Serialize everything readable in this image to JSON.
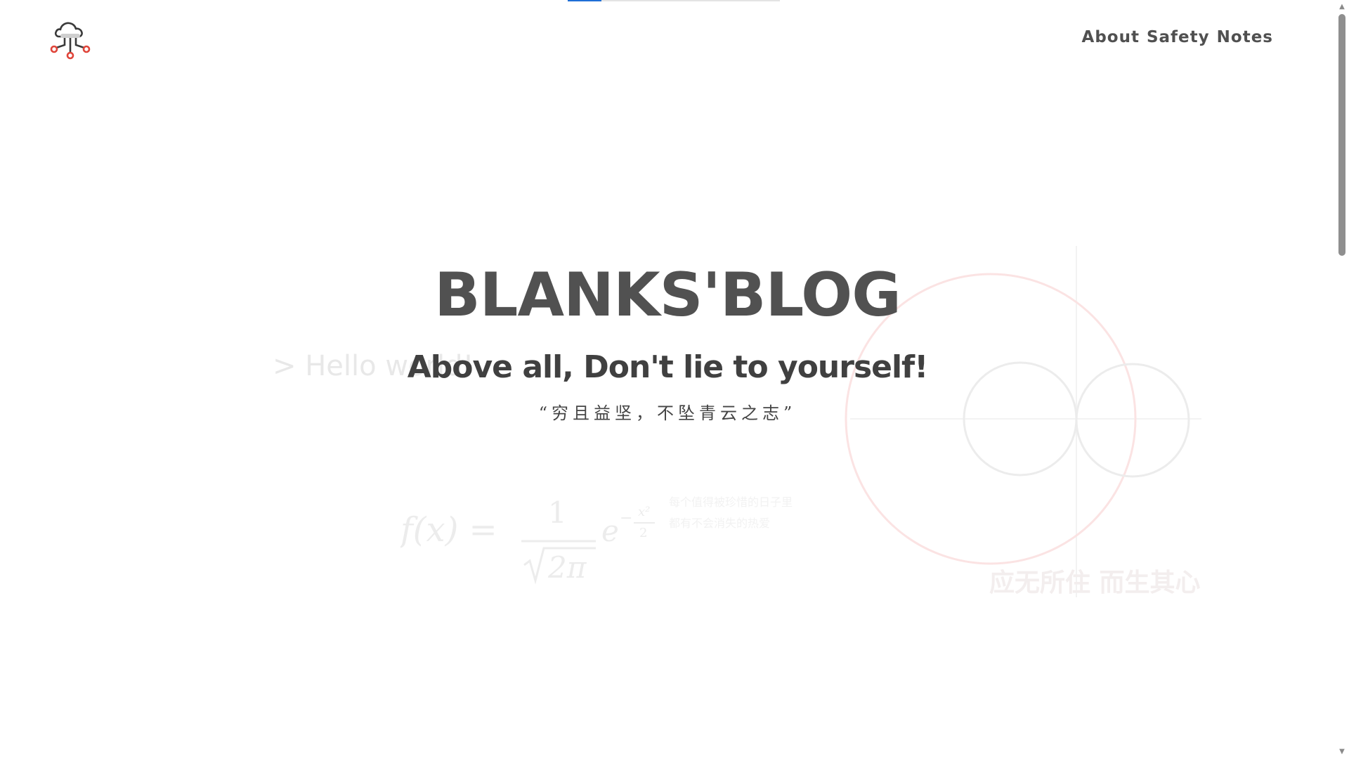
{
  "progress": {
    "value_percent": 16,
    "fill_color": "#1f6fd6",
    "track_color": "#e3e3e3"
  },
  "header": {
    "logo_icon": "cloud-network-icon",
    "nav": [
      {
        "label": "About"
      },
      {
        "label": "Safety"
      },
      {
        "label": "Notes"
      }
    ]
  },
  "hero": {
    "title": "BLANKS'BLOG",
    "subtitle": "Above all, Don't lie to yourself!",
    "quote": "“穷且益坚，不坠青云之志”"
  },
  "background": {
    "hello": "> Hello world!",
    "motto": "应无所住 而生其心",
    "note_lines": [
      "每个值得被珍惜的日子里",
      "都有不会消失的热爱"
    ]
  },
  "colors": {
    "accent_red": "#e0453a",
    "text_dark": "#515151"
  },
  "scrollbar": {
    "up_arrow": "▲",
    "down_arrow": "▼"
  }
}
